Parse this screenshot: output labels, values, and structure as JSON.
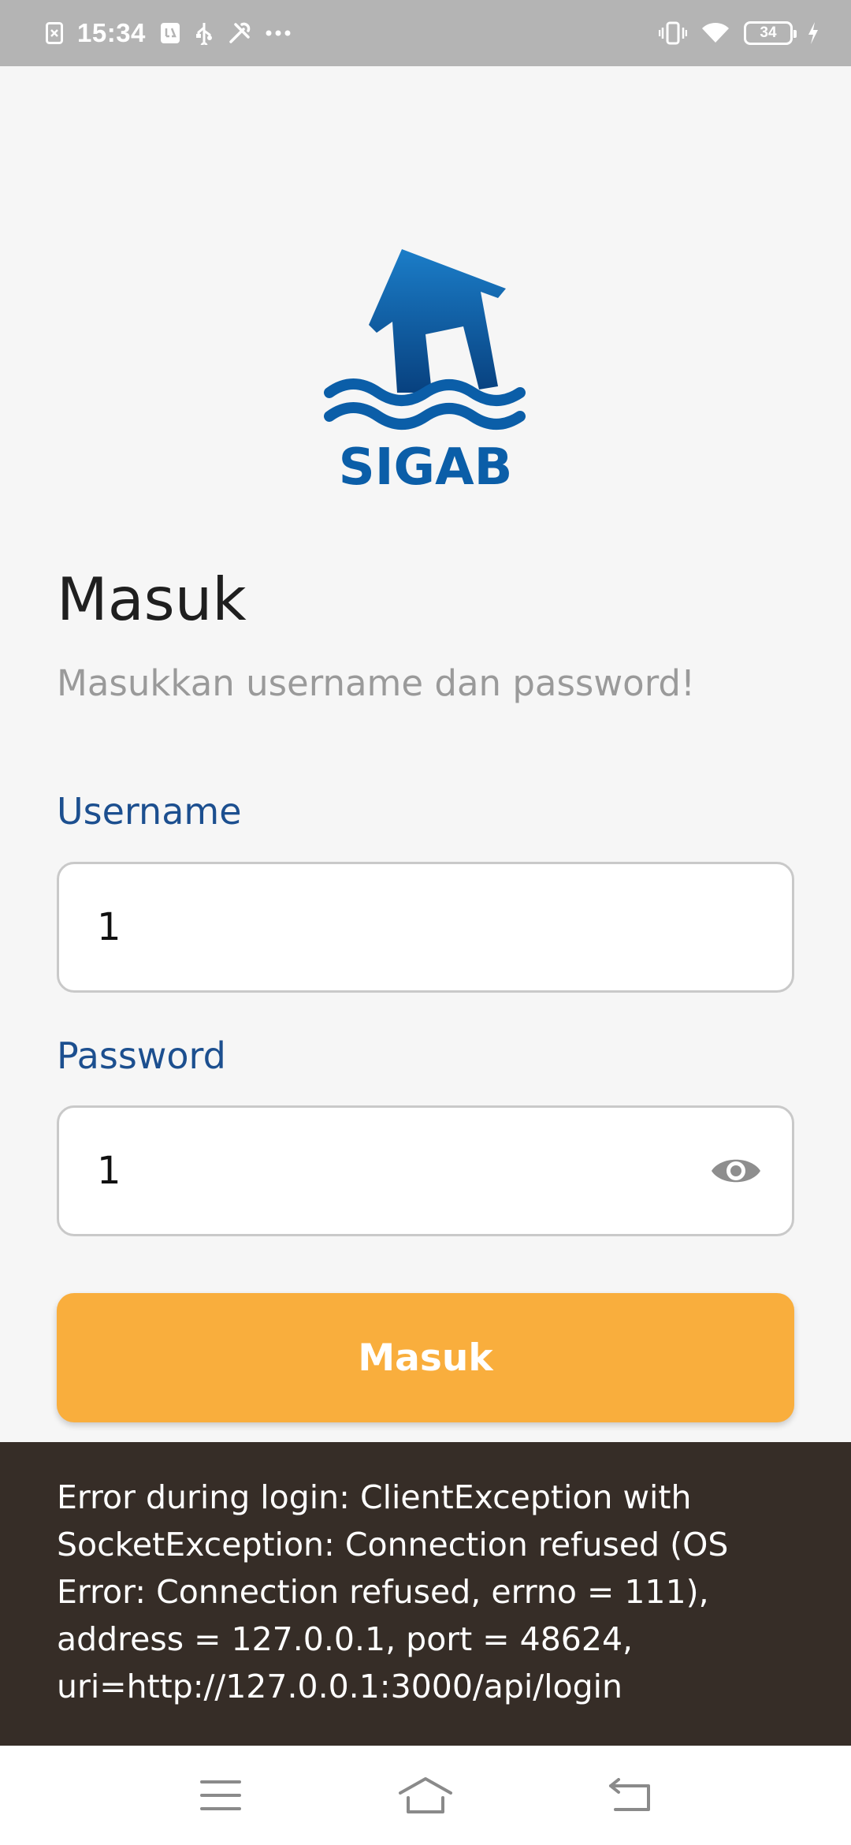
{
  "status_bar": {
    "time": "15:34",
    "battery_level": "34",
    "icons": [
      "notification-icon",
      "usb-debug-icon",
      "usb-icon",
      "tools-icon",
      "more-dots-icon",
      "vibrate-icon",
      "wifi-icon",
      "battery-icon",
      "charging-icon"
    ]
  },
  "logo": {
    "text": "SIGAB",
    "brand_color": "#0b5ea8"
  },
  "login": {
    "title": "Masuk",
    "subtitle": "Masukkan username dan password!",
    "username_label": "Username",
    "username_value": "1",
    "password_label": "Password",
    "password_value": "1",
    "submit_label": "Masuk"
  },
  "snackbar": {
    "message": "Error during login: ClientException with SocketException: Connection refused (OS Error: Connection refused, errno = 111), address = 127.0.0.1, port = 48624, uri=http://127.0.0.1:3000/api/login"
  },
  "nav_bar": {
    "icons": [
      "menu-icon",
      "home-icon",
      "back-icon"
    ]
  },
  "colors": {
    "label_blue": "#1c4f8f",
    "button_orange": "#f9ae3d",
    "snackbar_bg": "#362d27",
    "status_bar_bg": "#b4b4b4"
  }
}
